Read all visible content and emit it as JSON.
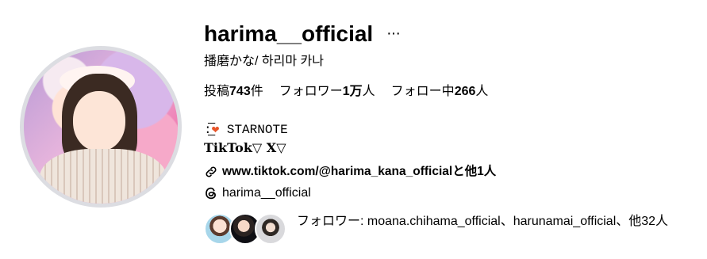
{
  "profile": {
    "username": "harima__official",
    "more_label": "···",
    "full_name": "播磨かな/ 하리마 카나",
    "stats": {
      "posts_prefix": "投稿",
      "posts_count": "743",
      "posts_suffix": "件",
      "followers_prefix": "フォロワー",
      "followers_count": "1万",
      "followers_suffix": "人",
      "following_prefix": "フォロー中",
      "following_count": "266",
      "following_suffix": "人"
    },
    "bio_line1_prefix": ":̲̅",
    "bio_line1_heart": "❤",
    "bio_line1_text": " STARNOTE",
    "bio_line2": "TikTok▽ X▽",
    "link_text": "www.tiktok.com/@harima_kana_officialと他1人",
    "threads_handle": "harima__official",
    "followed_by": "フォロワー: moana.chihama_official、harunamai_official、他32人"
  },
  "colors": {
    "ring": "#dcdde2",
    "heart": "#e8552a"
  },
  "icons": [
    "more-icon",
    "link-icon",
    "threads-icon"
  ]
}
